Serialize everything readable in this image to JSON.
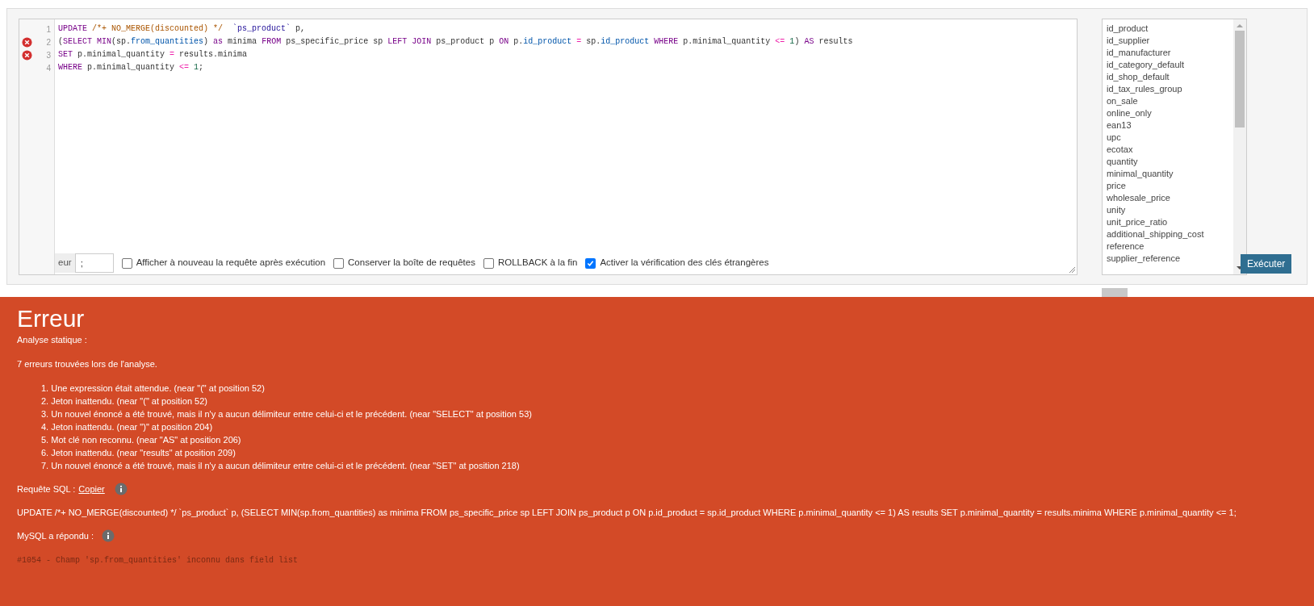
{
  "editor": {
    "lines": [
      {
        "number": "1",
        "error": false,
        "tokens": [
          {
            "text": "UPDATE",
            "kind": "keyword"
          },
          {
            "text": " /*+ NO_MERGE(discounted) */  ",
            "kind": "comment"
          },
          {
            "text": "`ps_product`",
            "kind": "string"
          },
          {
            "text": " p,",
            "kind": "plain"
          }
        ]
      },
      {
        "number": "2",
        "error": true,
        "tokens": [
          {
            "text": "(",
            "kind": "plain"
          },
          {
            "text": "SELECT ",
            "kind": "keyword"
          },
          {
            "text": "MIN",
            "kind": "keyword"
          },
          {
            "text": "(sp.",
            "kind": "plain"
          },
          {
            "text": "from_quantities",
            "kind": "variable"
          },
          {
            "text": ") ",
            "kind": "plain"
          },
          {
            "text": "as",
            "kind": "keyword"
          },
          {
            "text": " minima ",
            "kind": "plain"
          },
          {
            "text": "FROM",
            "kind": "keyword"
          },
          {
            "text": " ps_specific_price sp ",
            "kind": "plain"
          },
          {
            "text": "LEFT JOIN",
            "kind": "keyword"
          },
          {
            "text": " ps_product p ",
            "kind": "plain"
          },
          {
            "text": "ON",
            "kind": "keyword"
          },
          {
            "text": " p.",
            "kind": "plain"
          },
          {
            "text": "id_product",
            "kind": "variable"
          },
          {
            "text": " = ",
            "kind": "operator"
          },
          {
            "text": "sp.",
            "kind": "plain"
          },
          {
            "text": "id_product",
            "kind": "variable"
          },
          {
            "text": " WHERE",
            "kind": "keyword"
          },
          {
            "text": " p.minimal_quantity ",
            "kind": "plain"
          },
          {
            "text": "<= ",
            "kind": "operator"
          },
          {
            "text": "1",
            "kind": "number"
          },
          {
            "text": ") ",
            "kind": "plain"
          },
          {
            "text": "AS",
            "kind": "keyword"
          },
          {
            "text": " results",
            "kind": "plain"
          }
        ]
      },
      {
        "number": "3",
        "error": true,
        "tokens": [
          {
            "text": "SET",
            "kind": "keyword"
          },
          {
            "text": " p.minimal_quantity ",
            "kind": "plain"
          },
          {
            "text": "=",
            "kind": "operator"
          },
          {
            "text": " results.minima",
            "kind": "plain"
          }
        ]
      },
      {
        "number": "4",
        "error": false,
        "tokens": [
          {
            "text": "WHERE",
            "kind": "keyword"
          },
          {
            "text": " p.minimal_quantity ",
            "kind": "plain"
          },
          {
            "text": "<= ",
            "kind": "operator"
          },
          {
            "text": "1",
            "kind": "number"
          },
          {
            "text": ";",
            "kind": "plain"
          }
        ]
      }
    ]
  },
  "options": {
    "delimiter_label": "eur",
    "delimiter_value": ";",
    "checkboxes": [
      {
        "label": "Afficher à nouveau la requête après exécution",
        "checked": false
      },
      {
        "label": "Conserver la boîte de requêtes",
        "checked": false
      },
      {
        "label": "ROLLBACK à la fin",
        "checked": false
      },
      {
        "label": "Activer la vérification des clés étrangères",
        "checked": true
      }
    ]
  },
  "columns": [
    "id_product",
    "id_supplier",
    "id_manufacturer",
    "id_category_default",
    "id_shop_default",
    "id_tax_rules_group",
    "on_sale",
    "online_only",
    "ean13",
    "upc",
    "ecotax",
    "quantity",
    "minimal_quantity",
    "price",
    "wholesale_price",
    "unity",
    "unit_price_ratio",
    "additional_shipping_cost",
    "reference",
    "supplier_reference"
  ],
  "execute_button": "Exécuter",
  "error_panel": {
    "title": "Erreur",
    "subtitle": "Analyse statique :",
    "summary": "7 erreurs trouvées lors de l'analyse.",
    "errors": [
      {
        "number": "1.",
        "text": "Une expression était attendue. (near \"(\" at position 52)"
      },
      {
        "number": "2.",
        "text": "Jeton inattendu. (near \"(\" at position 52)"
      },
      {
        "number": "3.",
        "text": "Un nouvel énoncé a été trouvé, mais il n'y a aucun délimiteur entre celui-ci et le précédent. (near \"SELECT\" at position 53)"
      },
      {
        "number": "4.",
        "text": "Jeton inattendu. (near \")\" at position 204)"
      },
      {
        "number": "5.",
        "text": "Mot clé non reconnu. (near \"AS\" at position 206)"
      },
      {
        "number": "6.",
        "text": "Jeton inattendu. (near \"results\" at position 209)"
      },
      {
        "number": "7.",
        "text": "Un nouvel énoncé a été trouvé, mais il n'y a aucun délimiteur entre celui-ci et le précédent. (near \"SET\" at position 218)"
      }
    ],
    "sql_label": "Requête SQL :",
    "copy_link": "Copier",
    "sql_text": "UPDATE /*+ NO_MERGE(discounted) */ `ps_product` p, (SELECT MIN(sp.from_quantities) as minima FROM ps_specific_price sp LEFT JOIN ps_product p ON p.id_product = sp.id_product WHERE p.minimal_quantity <= 1) AS results SET p.minimal_quantity = results.minima WHERE p.minimal_quantity <= 1;",
    "mysql_label": "MySQL a répondu :",
    "mysql_response": "#1054 - Champ 'sp.from_quantities' inconnu dans field list"
  }
}
